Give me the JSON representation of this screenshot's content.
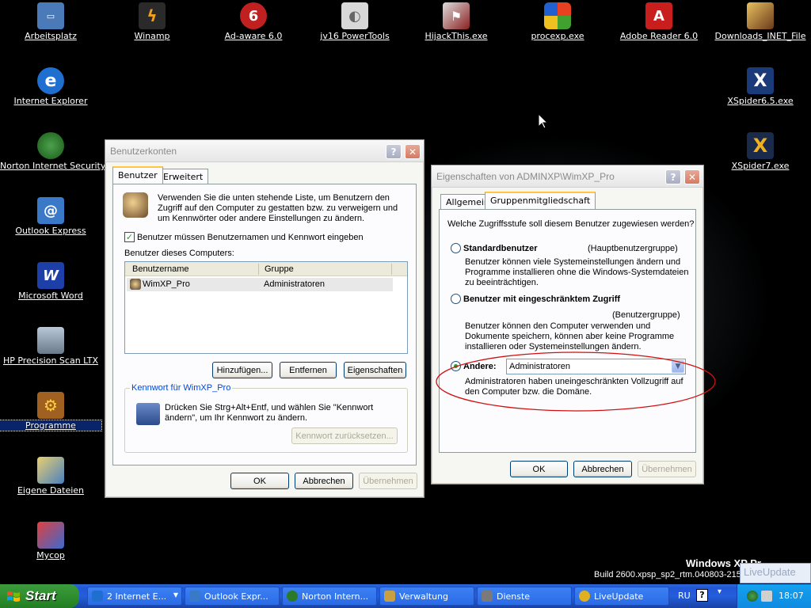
{
  "desktop": {
    "icons": [
      {
        "name": "icon-arbeitsplatz",
        "label": "Arbeitsplatz",
        "glyph": "🖥",
        "bg": "#4a7ab8"
      },
      {
        "name": "icon-internet-explorer",
        "label": "Internet Explorer",
        "glyph": "e",
        "bg": "#1f6fd1"
      },
      {
        "name": "icon-norton-internet-security",
        "label": "Norton Internet Security",
        "glyph": "◉",
        "bg": "#2a7a2a"
      },
      {
        "name": "icon-outlook-express",
        "label": "Outlook Express",
        "glyph": "@",
        "bg": "#3a78c8"
      },
      {
        "name": "icon-microsoft-word",
        "label": "Microsoft Word",
        "glyph": "W",
        "bg": "#1f3fa8"
      },
      {
        "name": "icon-hp-precision-scan",
        "label": "HP Precision Scan LTX",
        "glyph": "▭",
        "bg": "#8a9aaa"
      },
      {
        "name": "icon-programme",
        "label": "Programme",
        "glyph": "⚙",
        "bg": "#a06020"
      },
      {
        "name": "icon-eigene-dateien",
        "label": "Eigene Dateien",
        "glyph": "✎",
        "bg": "#c0a040"
      },
      {
        "name": "icon-mycop",
        "label": "Mycop",
        "glyph": "✉",
        "bg": "#c03030"
      },
      {
        "name": "icon-winamp",
        "label": "Winamp",
        "glyph": "⚡",
        "bg": "#2a2a2a"
      },
      {
        "name": "icon-ad-aware",
        "label": "Ad-aware 6.0",
        "glyph": "6",
        "bg": "#c02020"
      },
      {
        "name": "icon-jv16-powertools",
        "label": "jv16 PowerTools",
        "glyph": "💡",
        "bg": "#d8d8d8"
      },
      {
        "name": "icon-hijackthis",
        "label": "HijackThis.exe",
        "glyph": "⚑",
        "bg": "#8a2020"
      },
      {
        "name": "icon-procexp",
        "label": "procexp.exe",
        "glyph": "⊞",
        "bg": "#2a7ad0"
      },
      {
        "name": "icon-adobe-reader",
        "label": "Adobe Reader 6.0",
        "glyph": "A",
        "bg": "#c81e1e"
      },
      {
        "name": "icon-downloads-inet",
        "label": "Downloads_INET_File",
        "glyph": "▦",
        "bg": "#6a5a4a"
      },
      {
        "name": "icon-xspider65",
        "label": "XSpider6.5.exe",
        "glyph": "X",
        "bg": "#1a3a7a"
      },
      {
        "name": "icon-xspider7",
        "label": "XSpider7.exe",
        "glyph": "X",
        "bg": "#c89018"
      }
    ]
  },
  "xp_watermark": {
    "line1": "Windows XP Pr…",
    "line2": "Build 2600.xpsp_sp2_rtm.040803-215"
  },
  "benutzerkonten": {
    "title": "Benutzerkonten",
    "tabs": [
      "Benutzer",
      "Erweitert"
    ],
    "intro": "Verwenden Sie die unten stehende Liste, um Benutzern den Zugriff auf den Computer zu gestatten bzw. zu verweigern und um Kennwörter oder andere Einstellungen zu ändern.",
    "checkbox_label": "Benutzer müssen Benutzernamen und Kennwort eingeben",
    "list_caption": "Benutzer dieses Computers:",
    "columns": [
      "Benutzername",
      "Gruppe"
    ],
    "rows": [
      {
        "user": "WimXP_Pro",
        "group": "Administratoren"
      }
    ],
    "buttons": {
      "add": "Hinzufügen...",
      "remove": "Entfernen",
      "properties": "Eigenschaften"
    },
    "password_group": "Kennwort für WimXP_Pro",
    "password_text": "Drücken Sie Strg+Alt+Entf, und wählen Sie \"Kennwort ändern\", um Ihr Kennwort zu ändern.",
    "reset_button": "Kennwort zurücksetzen...",
    "ok": "OK",
    "cancel": "Abbrechen",
    "apply": "Übernehmen"
  },
  "eigenschaften": {
    "title": "Eigenschaften von ADMINXP\\WimXP_Pro",
    "tabs": [
      "Allgemein",
      "Gruppenmitgliedschaft"
    ],
    "question": "Welche Zugriffsstufe soll diesem Benutzer zugewiesen werden?",
    "opt1_label": "Standardbenutzer",
    "opt1_group": "(Hauptbenutzergruppe)",
    "opt1_desc": "Benutzer können viele Systemeinstellungen ändern und Programme installieren ohne die Windows-Systemdateien zu beeinträchtigen.",
    "opt2_label": "Benutzer mit eingeschränktem Zugriff",
    "opt2_group": "(Benutzergruppe)",
    "opt2_desc": "Benutzer können den Computer verwenden und Dokumente speichern, können aber keine Programme installieren oder Systemeinstellungen ändern.",
    "opt3_label": "Andere:",
    "opt3_select": "Administratoren",
    "opt3_desc": "Administratoren haben uneingeschränkten Vollzugriff auf den Computer bzw. die Domäne.",
    "ok": "OK",
    "cancel": "Abbrechen",
    "apply": "Übernehmen"
  },
  "taskbar": {
    "start": "Start",
    "items": [
      {
        "name": "task-internet-explorer",
        "label": "2 Internet E...",
        "color": "#1f6fd1"
      },
      {
        "name": "task-outlook-express",
        "label": "Outlook Expr...",
        "color": "#3a78c8"
      },
      {
        "name": "task-norton",
        "label": "Norton Intern...",
        "color": "#2a7a2a"
      },
      {
        "name": "task-verwaltung",
        "label": "Verwaltung",
        "color": "#c8a040"
      },
      {
        "name": "task-dienste",
        "label": "Dienste",
        "color": "#7a7a7a"
      },
      {
        "name": "task-liveupdate",
        "label": "LiveUpdate",
        "color": "#e0b020"
      }
    ],
    "lang": "RU",
    "clock": "18:07",
    "liveupdate_popup": "LiveUpdate"
  }
}
